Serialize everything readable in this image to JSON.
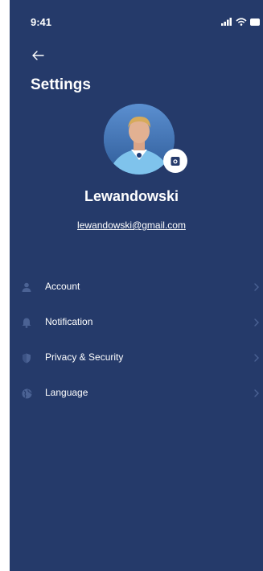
{
  "status_bar": {
    "time": "9:41"
  },
  "header": {
    "title": "Settings"
  },
  "profile": {
    "name": "Lewandowski",
    "email": "lewandowski@gmail.com"
  },
  "menu": {
    "items": [
      {
        "label": "Account",
        "icon": "person-icon"
      },
      {
        "label": "Notification",
        "icon": "bell-icon"
      },
      {
        "label": "Privacy & Security",
        "icon": "shield-icon"
      },
      {
        "label": "Language",
        "icon": "globe-icon"
      }
    ]
  },
  "colors": {
    "background": "#253a6a",
    "text": "#ffffff",
    "muted_icon": "#4b6294"
  }
}
